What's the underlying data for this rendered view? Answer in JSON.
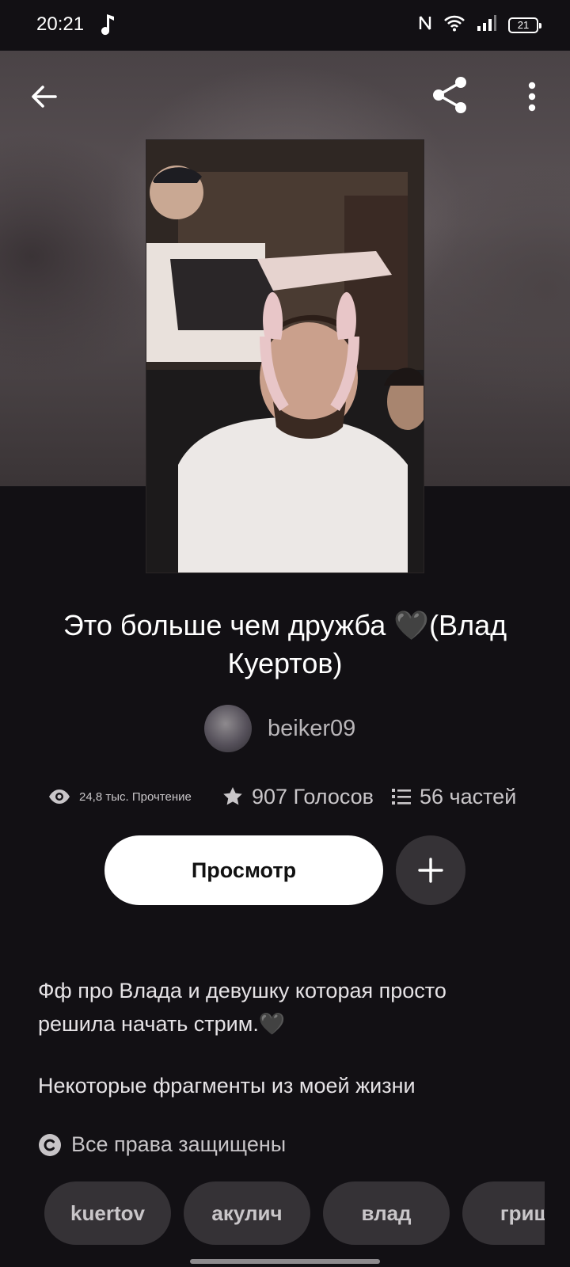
{
  "status_bar": {
    "time": "20:21",
    "battery": "21",
    "icons": [
      "music-note-icon",
      "nfc-icon",
      "wifi-icon",
      "signal-icon",
      "battery-icon"
    ]
  },
  "header": {
    "back_icon": "arrow-left-icon",
    "share_icon": "share-icon",
    "more_icon": "more-vertical-icon"
  },
  "story": {
    "title": "Это больше чем дружба 🖤(Влад Куертов)",
    "author": "beiker09",
    "stats": {
      "reads": "24,8 тыс. Прочтение",
      "votes": "907 Голосов",
      "parts": "56 частей"
    },
    "view_label": "Просмотр",
    "description": [
      "Фф про Влада и девушку которая просто решила начать стрим.🖤",
      "Некоторые фрагменты из моей жизни"
    ],
    "copyright": "Все права защищены",
    "tags": [
      "kuertov",
      "акулич",
      "влад",
      "гриш"
    ]
  },
  "colors": {
    "background": "#121014",
    "chip": "#353236",
    "primary_button": "#ffffff"
  }
}
